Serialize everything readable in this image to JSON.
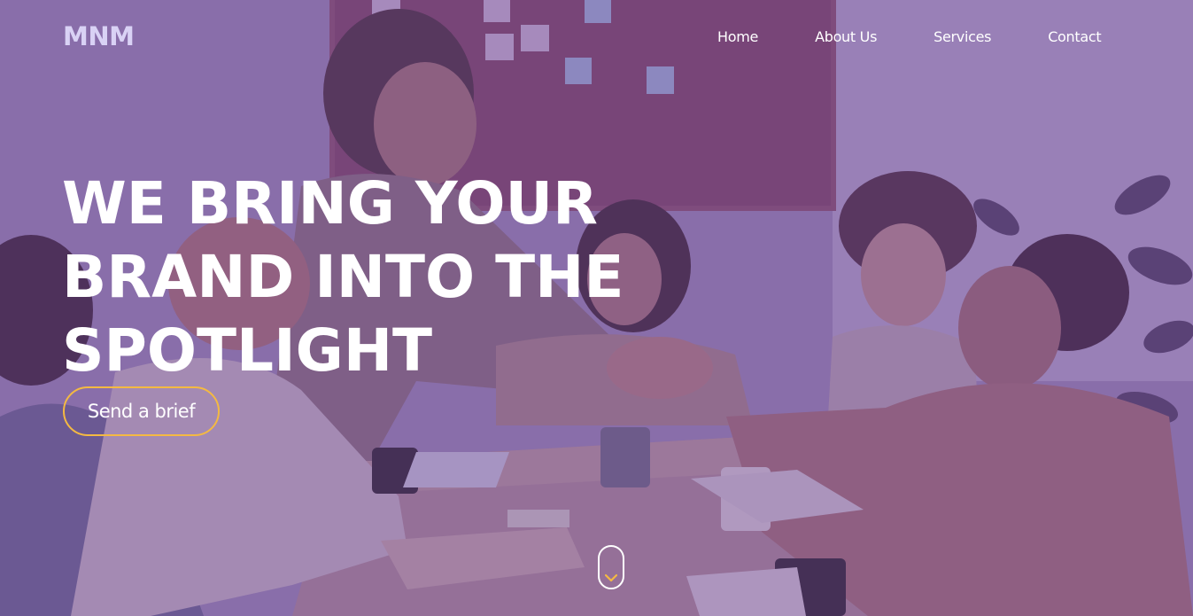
{
  "brand": {
    "logo": "MNM"
  },
  "nav": {
    "items": [
      {
        "label": "Home"
      },
      {
        "label": "About Us"
      },
      {
        "label": "Services"
      },
      {
        "label": "Contact"
      }
    ]
  },
  "hero": {
    "headline_lines": [
      "WE BRING YOUR",
      "BRAND INTO THE",
      "SPOTLIGHT"
    ],
    "cta_label": "Send a brief",
    "scroll_icon": "chevron-down-icon",
    "background_image": "team-meeting-handshake-photo"
  },
  "colors": {
    "overlay": "#8a6c9e",
    "accent": "#f4b942",
    "logo": "#d9d2f5",
    "text": "#ffffff"
  }
}
